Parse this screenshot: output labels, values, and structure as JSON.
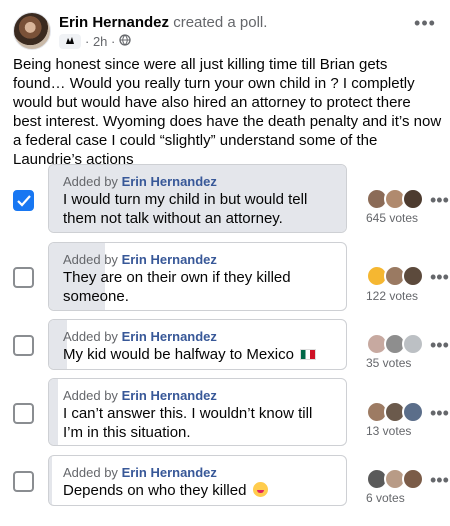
{
  "post": {
    "author": "Erin Hernandez",
    "action": "created a poll.",
    "time": "2h",
    "text": "Being honest since were all just killing time till Brian gets found… Would you really turn your own child in ? I completly would but would have also hired an attorney to protect there best interest. Wyoming does have the death penalty and it’s now a federal case I could “slightly” understand some of the Laundrie’s actions"
  },
  "icons": {
    "audience": "globe-icon",
    "group": "group-badge-icon",
    "more": "more-options-icon",
    "checkbox": "checkbox-icon"
  },
  "colors": {
    "accent": "#1877f2",
    "link": "#385898",
    "muted": "#65676b"
  },
  "poll": {
    "options": [
      {
        "added_by_prefix": "Added by",
        "added_by": "Erin Hernandez",
        "text": "I would turn my child in but would tell them not talk without an attorney.",
        "votes": "645 votes",
        "checked": true
      },
      {
        "added_by_prefix": "Added by",
        "added_by": "Erin Hernandez",
        "text": "They are on their own if they killed someone.",
        "votes": "122 votes",
        "checked": false
      },
      {
        "added_by_prefix": "Added by",
        "added_by": "Erin Hernandez",
        "text": "My kid would be halfway to Mexico",
        "votes": "35 votes",
        "checked": false
      },
      {
        "added_by_prefix": "Added by",
        "added_by": "Erin Hernandez",
        "text": "I can’t answer this. I wouldn’t know till I’m in this situation.",
        "votes": "13 votes",
        "checked": false
      },
      {
        "added_by_prefix": "Added by",
        "added_by": "Erin Hernandez",
        "text": "Depends on who they killed",
        "votes": "6 votes",
        "checked": false
      }
    ]
  }
}
